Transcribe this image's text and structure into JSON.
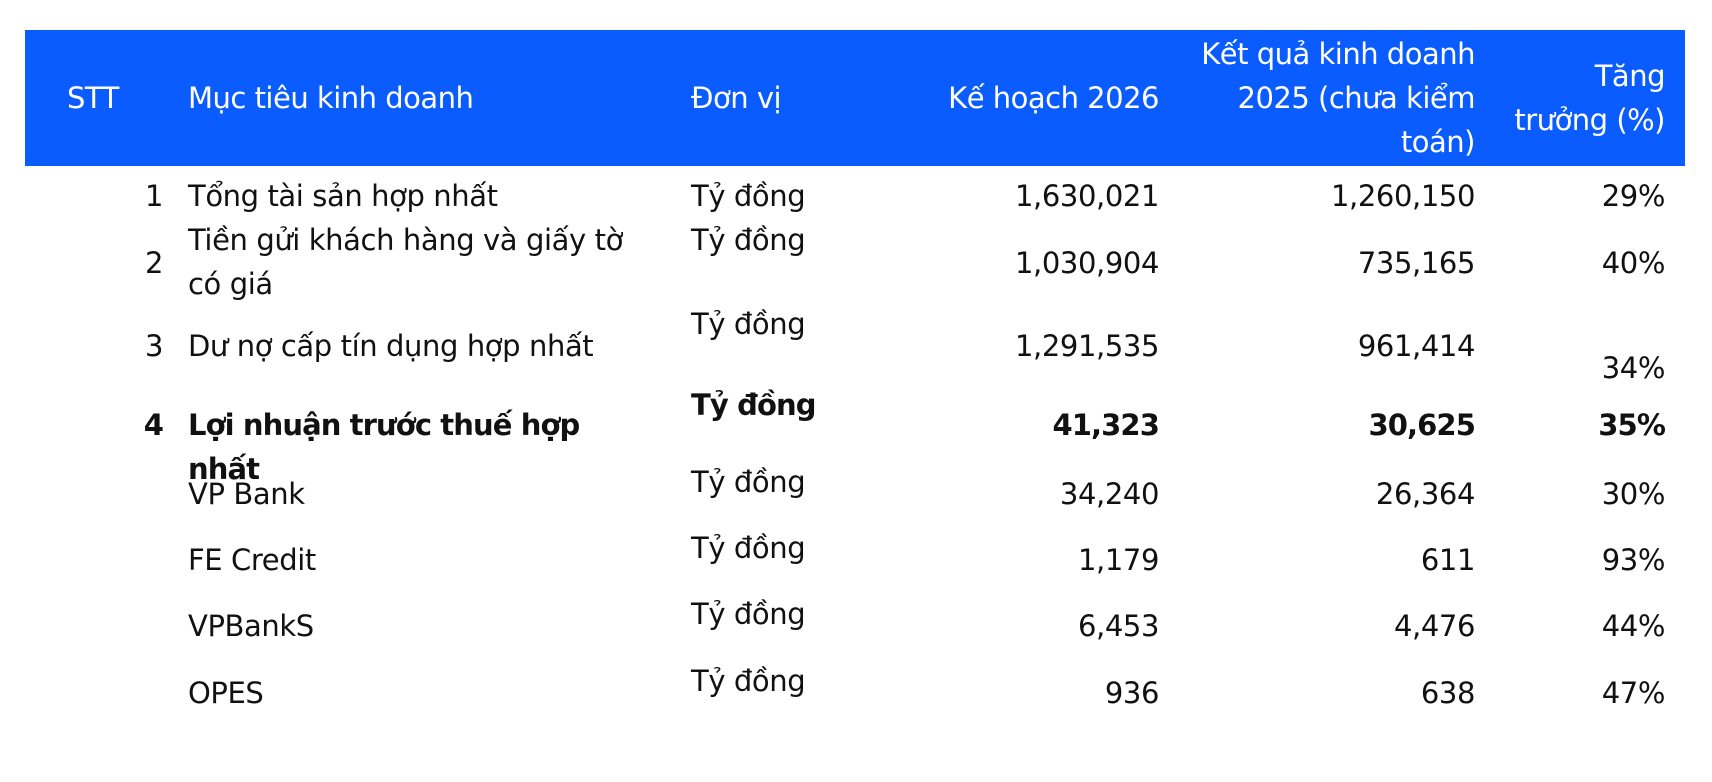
{
  "header": {
    "stt": "STT",
    "goal": "Mục tiêu kinh doanh",
    "unit": "Đơn vị",
    "plan": "Kế hoạch 2026",
    "result": "Kết quả kinh doanh 2025 (chưa kiểm toán)",
    "growth": "Tăng trưởng (%)"
  },
  "rows": [
    {
      "stt": "1",
      "goal": "Tổng tài sản hợp nhất",
      "unit": "Tỷ đồng",
      "plan": "1,630,021",
      "result": "1,260,150",
      "growth": "29%"
    },
    {
      "stt": "2",
      "goal": "Tiền gửi khách hàng và giấy tờ có giá",
      "unit": "Tỷ đồng",
      "plan": "1,030,904",
      "result": "735,165",
      "growth": "40%"
    },
    {
      "stt": "3",
      "goal": "Dư nợ cấp tín dụng hợp nhất",
      "unit": "Tỷ đồng",
      "plan": "1,291,535",
      "result": "961,414",
      "growth": "34%"
    },
    {
      "stt": "4",
      "goal": "Lợi nhuận trước thuế hợp nhất",
      "unit": "Tỷ đồng",
      "plan": "41,323",
      "result": "30,625",
      "growth": "35%"
    },
    {
      "stt": "",
      "goal": "VP Bank",
      "unit": "Tỷ đồng",
      "plan": "34,240",
      "result": "26,364",
      "growth": "30%"
    },
    {
      "stt": "",
      "goal": "FE Credit",
      "unit": "Tỷ đồng",
      "plan": "1,179",
      "result": "611",
      "growth": "93%"
    },
    {
      "stt": "",
      "goal": "VPBankS",
      "unit": "Tỷ đồng",
      "plan": "6,453",
      "result": "4,476",
      "growth": "44%"
    },
    {
      "stt": "",
      "goal": "OPES",
      "unit": "Tỷ đồng",
      "plan": "936",
      "result": "638",
      "growth": "47%"
    }
  ]
}
